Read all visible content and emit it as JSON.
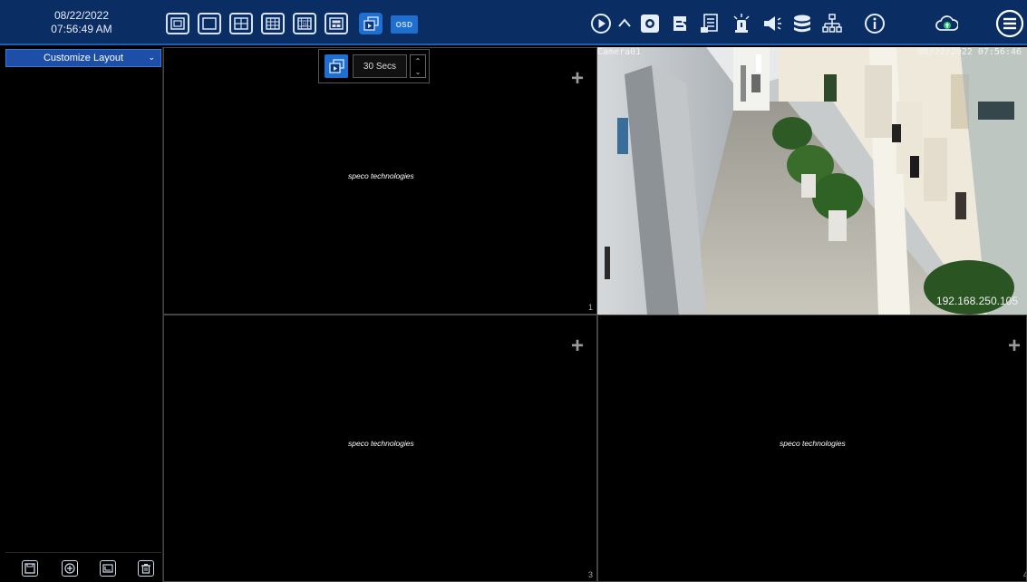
{
  "clock": {
    "date": "08/22/2022",
    "time": "07:56:49 AM"
  },
  "toolbar": {
    "layout_buttons": [
      "fullscreen-layout-icon",
      "single-layout-icon",
      "quad-layout-icon",
      "nine-layout-icon",
      "sixteen-layout-icon",
      "pip-layout-icon",
      "sequence-icon"
    ],
    "osd_label": "OSD",
    "sixteen_label": "16",
    "right_icons": [
      "playback-icon",
      "collapse-chevron-icon",
      "snapshot-icon",
      "record-icon",
      "log-icon",
      "alarm-icon",
      "audio-icon",
      "disk-icon",
      "network-icon",
      "info-icon",
      "cloud-upload-icon",
      "main-menu-icon"
    ],
    "accent": "#1e6fd0",
    "bar_color": "#0a2d63"
  },
  "sidebar": {
    "layout_select": "Customize Layout",
    "bottom_buttons": [
      "save-icon",
      "add-icon",
      "rename-icon",
      "delete-icon"
    ]
  },
  "sequence": {
    "interval": "30 Secs"
  },
  "tiles": [
    {
      "id": "tile-1",
      "logo": "speco technologies",
      "number": "1"
    },
    {
      "id": "tile-3",
      "logo": "speco technologies",
      "number": "3"
    },
    {
      "id": "tile-4",
      "logo": "speco technologies",
      "number": "4"
    }
  ],
  "camera": {
    "name": "Camera01",
    "timestamp": "08/22/2022 07:56:46",
    "ip": "192.168.250.105"
  }
}
